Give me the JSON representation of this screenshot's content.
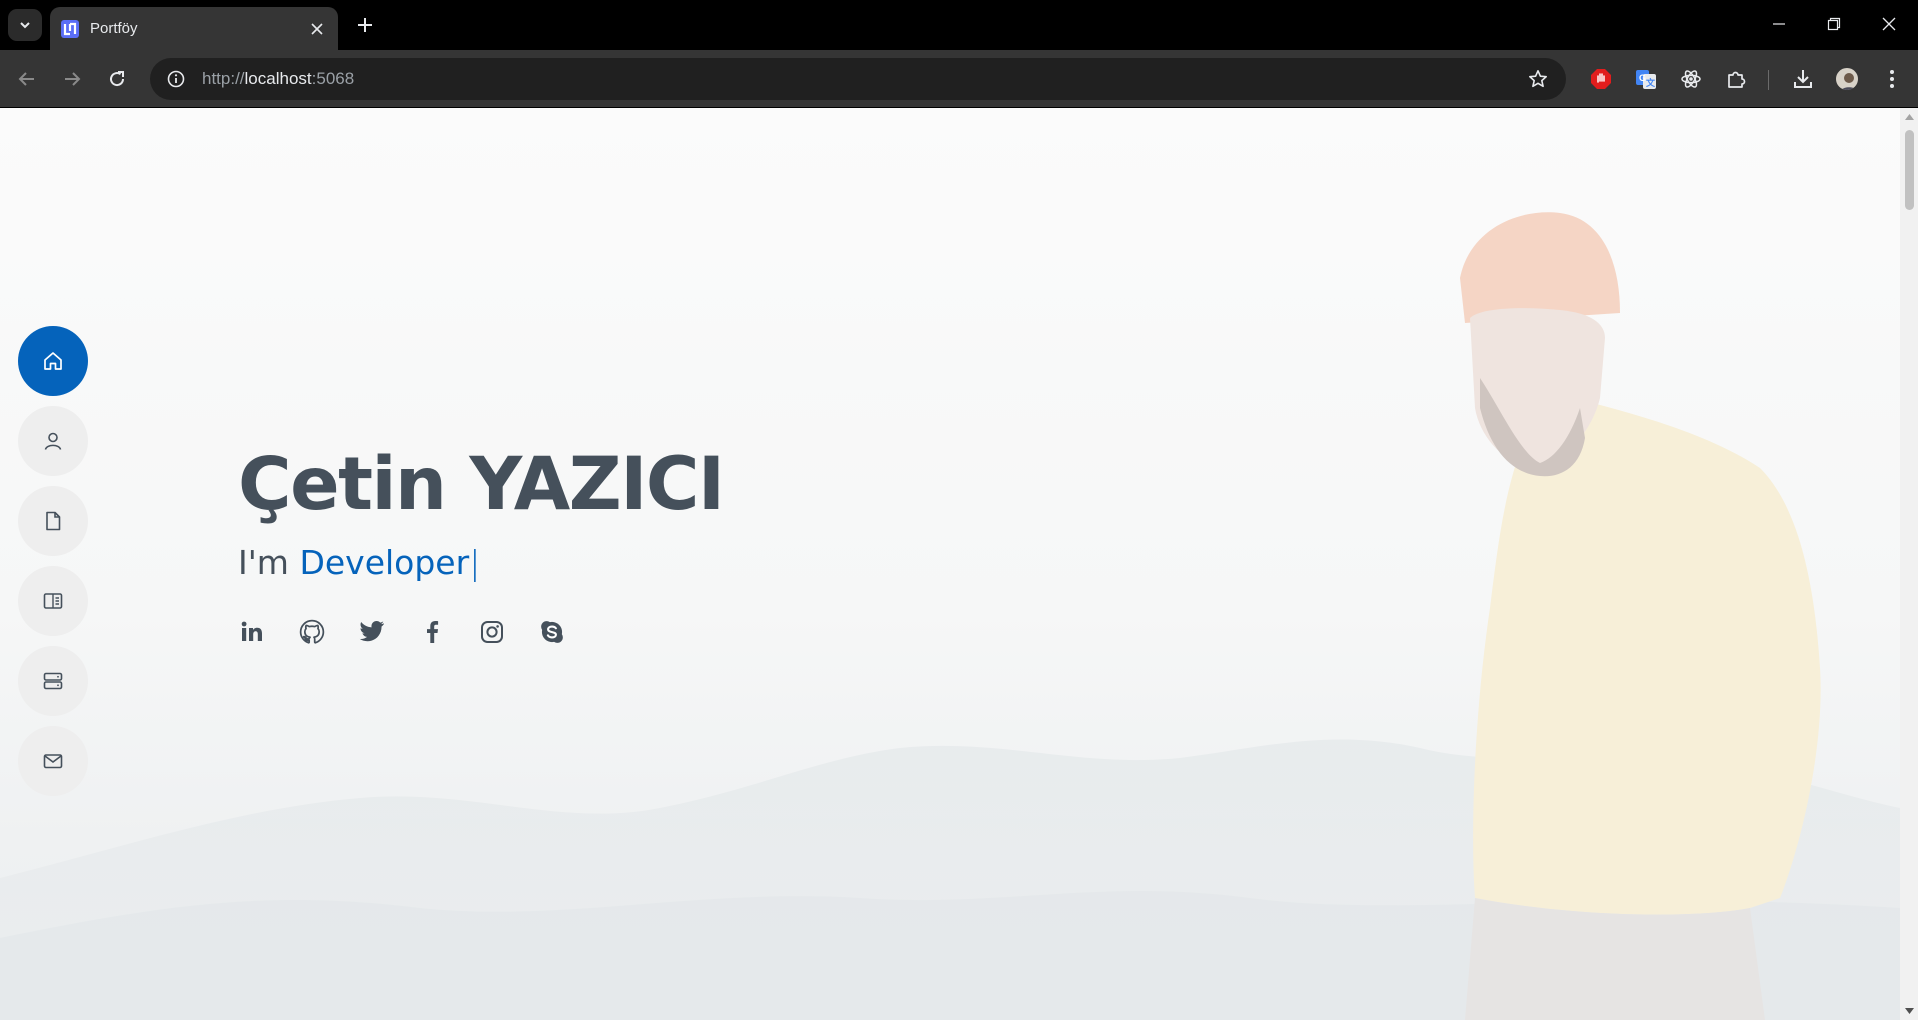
{
  "browser": {
    "tab_title": "Portföy",
    "url_scheme": "http://",
    "url_host": "localhost",
    "url_port": ":5068"
  },
  "page": {
    "name": "Çetin YAZICI",
    "tagline_prefix": "I'm ",
    "tagline_role": "Developer",
    "tagline_cursor": "|",
    "accent_color": "#0563bb",
    "text_color": "#45505b",
    "nav_items": [
      {
        "icon": "house-icon",
        "active": true
      },
      {
        "icon": "person-icon",
        "active": false
      },
      {
        "icon": "file-icon",
        "active": false
      },
      {
        "icon": "book-icon",
        "active": false
      },
      {
        "icon": "server-icon",
        "active": false
      },
      {
        "icon": "envelope-icon",
        "active": false
      }
    ],
    "social_links": [
      "linkedin-icon",
      "github-icon",
      "twitter-icon",
      "facebook-icon",
      "instagram-icon",
      "skype-icon"
    ]
  }
}
